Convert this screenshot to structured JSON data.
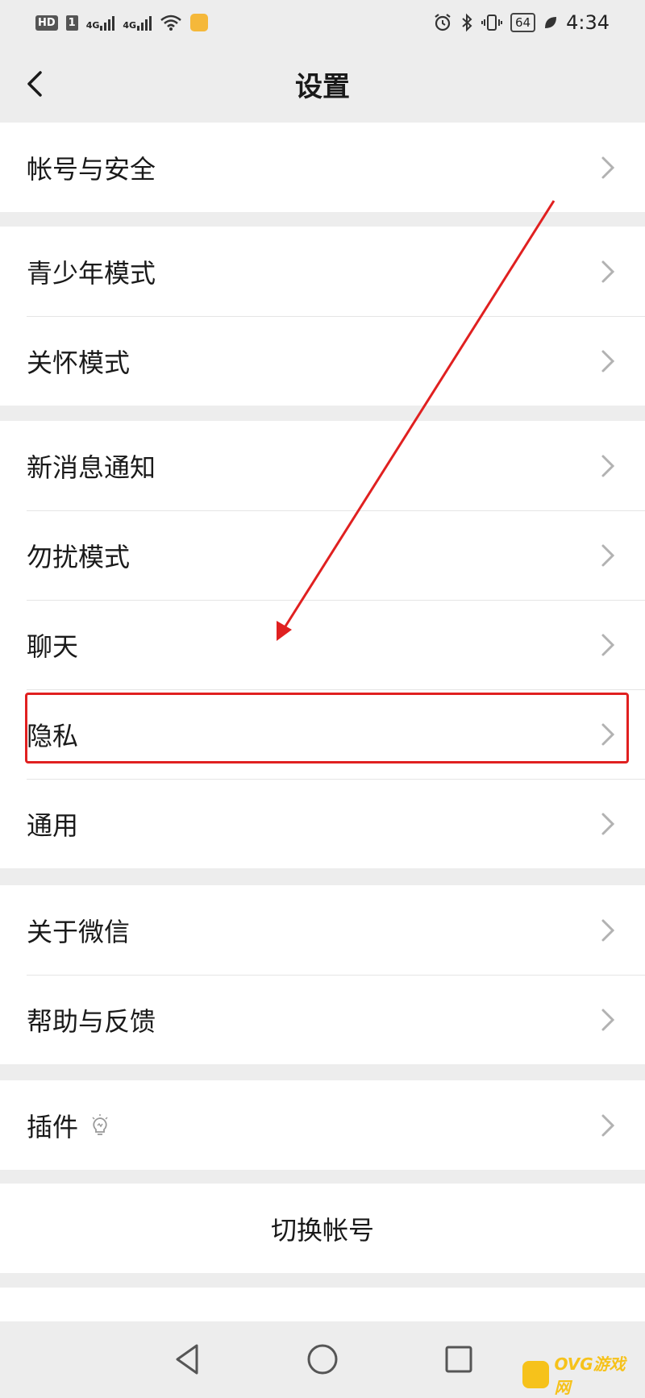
{
  "status_bar": {
    "hd": "HD",
    "sim": "1",
    "network_1": "4G",
    "network_2": "4G",
    "battery": "64",
    "time": "4:34"
  },
  "header": {
    "title": "设置",
    "back_icon": "chevron-left-icon"
  },
  "groups": [
    {
      "items": [
        {
          "label": "帐号与安全"
        }
      ]
    },
    {
      "items": [
        {
          "label": "青少年模式"
        },
        {
          "label": "关怀模式"
        }
      ]
    },
    {
      "items": [
        {
          "label": "新消息通知"
        },
        {
          "label": "勿扰模式"
        },
        {
          "label": "聊天"
        },
        {
          "label": "隐私"
        },
        {
          "label": "通用"
        }
      ]
    },
    {
      "items": [
        {
          "label": "关于微信"
        },
        {
          "label": "帮助与反馈"
        }
      ]
    },
    {
      "items": [
        {
          "label": "插件",
          "icon": "lightbulb-icon"
        }
      ]
    }
  ],
  "switch_account": {
    "label": "切换帐号"
  },
  "annotation": {
    "highlighted_item": "隐私",
    "color": "#e02020"
  },
  "nav_bar": {
    "back": "triangle-back-icon",
    "home": "circle-home-icon",
    "recent": "square-recents-icon"
  },
  "watermark": {
    "text": "OVG游戏网"
  }
}
